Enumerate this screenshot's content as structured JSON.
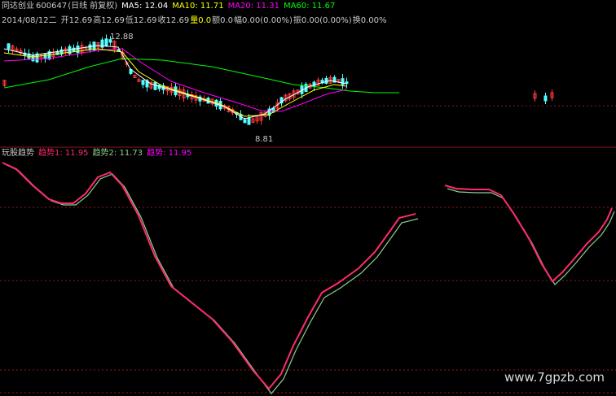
{
  "header": {
    "name": "同达创业",
    "code": "600647",
    "period": "(日线 前复权)",
    "ma5": "MA5: 12.04",
    "ma10": "MA10: 11.71",
    "ma20": "MA20: 11.31",
    "ma60": "MA60: 11.67"
  },
  "quote": {
    "date": "2014/08/12二",
    "open": "开12.69",
    "high": "高12.69",
    "low": "低12.69",
    "close": "收12.69",
    "volume": "量0.0",
    "amount": "额0.0",
    "change": "幅0.00(0.00%)",
    "amplitude": "振0.00(0.00%)",
    "turnover": "换0.00%"
  },
  "price_labels": {
    "high_mark": "12.88",
    "low_mark": "8.81"
  },
  "indicator": {
    "name": "玩股趋势",
    "line1": "趋势1: 11.95",
    "line2": "趋势2: 11.73",
    "line3": "趋势: 11.95"
  },
  "watermark": "www.7gpzb.com",
  "colors": {
    "up": "#ff3838",
    "down": "#54ffff",
    "ma5": "#ffffff",
    "ma10": "#ffff00",
    "ma20": "#ff00ff",
    "ma60": "#00ff00",
    "trend1": "#ff2a6d",
    "trend2": "#8cd08c",
    "label_gray": "#b0b0b0",
    "grid": "#8b1a1a"
  }
}
